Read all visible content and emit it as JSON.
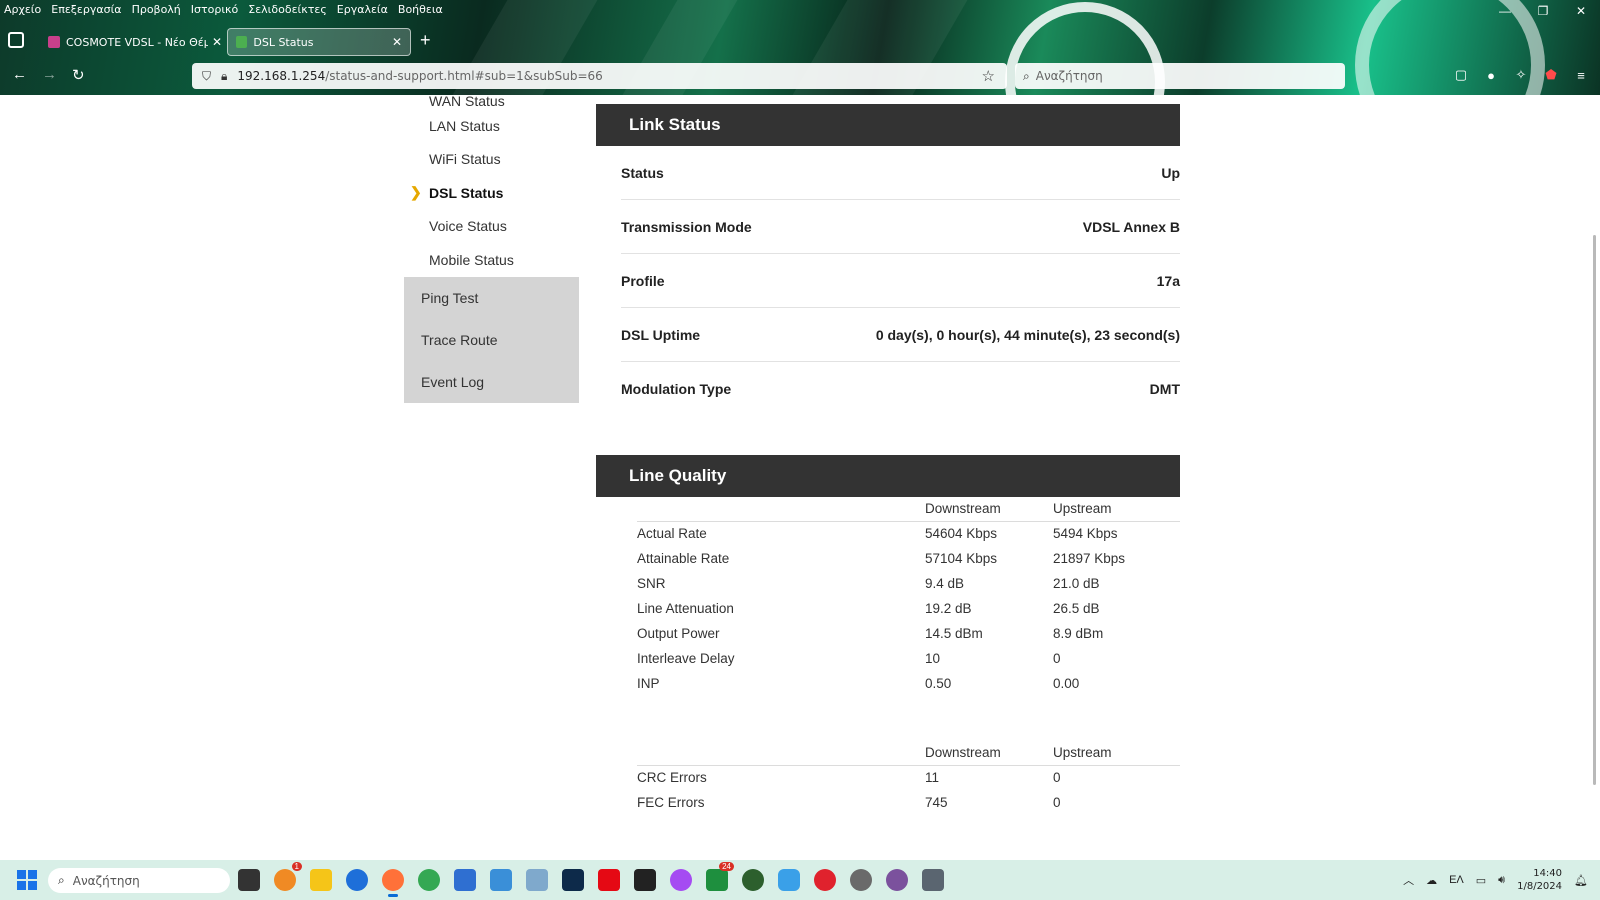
{
  "browser": {
    "menu": [
      "Αρχείο",
      "Επεξεργασία",
      "Προβολή",
      "Ιστορικό",
      "Σελιδοδείκτες",
      "Εργαλεία",
      "Βοήθεια"
    ],
    "tabs": [
      {
        "title": "COSMOTE VDSL - Νέο Θέμα",
        "active": false
      },
      {
        "title": "DSL Status",
        "active": true
      }
    ],
    "url_host": "192.168.1.254",
    "url_rest": "/status-and-support.html#sub=1&subSub=66",
    "search_placeholder": "Αναζήτηση"
  },
  "sidebar": {
    "sub_items": [
      {
        "label": "WAN Status"
      },
      {
        "label": "LAN Status"
      },
      {
        "label": "WiFi Status"
      },
      {
        "label": "DSL Status",
        "active": true
      },
      {
        "label": "Voice Status"
      },
      {
        "label": "Mobile Status"
      }
    ],
    "main_items": [
      {
        "label": "Ping Test"
      },
      {
        "label": "Trace Route"
      },
      {
        "label": "Event Log"
      }
    ]
  },
  "link_status": {
    "title": "Link Status",
    "rows": [
      {
        "key": "Status",
        "value": "Up"
      },
      {
        "key": "Transmission Mode",
        "value": "VDSL Annex B"
      },
      {
        "key": "Profile",
        "value": "17a"
      },
      {
        "key": "DSL Uptime",
        "value": "0 day(s), 0 hour(s), 44 minute(s), 23 second(s)"
      },
      {
        "key": "Modulation Type",
        "value": "DMT"
      }
    ]
  },
  "line_quality": {
    "title": "Line Quality",
    "headers": [
      "",
      "Downstream",
      "Upstream"
    ],
    "rows": [
      [
        "Actual Rate",
        "54604 Kbps",
        "5494 Kbps"
      ],
      [
        "Attainable Rate",
        "57104 Kbps",
        "21897 Kbps"
      ],
      [
        "SNR",
        "9.4 dB",
        "21.0 dB"
      ],
      [
        "Line Attenuation",
        "19.2 dB",
        "26.5 dB"
      ],
      [
        "Output Power",
        "14.5 dBm",
        "8.9 dBm"
      ],
      [
        "Interleave Delay",
        "10",
        "0"
      ],
      [
        "INP",
        "0.50",
        "0.00"
      ]
    ],
    "errors_headers": [
      "",
      "Downstream",
      "Upstream"
    ],
    "errors_rows": [
      [
        "CRC Errors",
        "11",
        "0"
      ],
      [
        "FEC Errors",
        "745",
        "0"
      ]
    ]
  },
  "taskbar": {
    "search_placeholder": "Αναζήτηση",
    "badge_firefox": "1",
    "badge_app": "24",
    "lang": "ΕΛ",
    "time": "14:40",
    "date": "1/8/2024"
  },
  "colors": {
    "panel_header": "#333333",
    "active_chevron": "#e6a800",
    "nav_group_bg": "#d4d4d4"
  }
}
